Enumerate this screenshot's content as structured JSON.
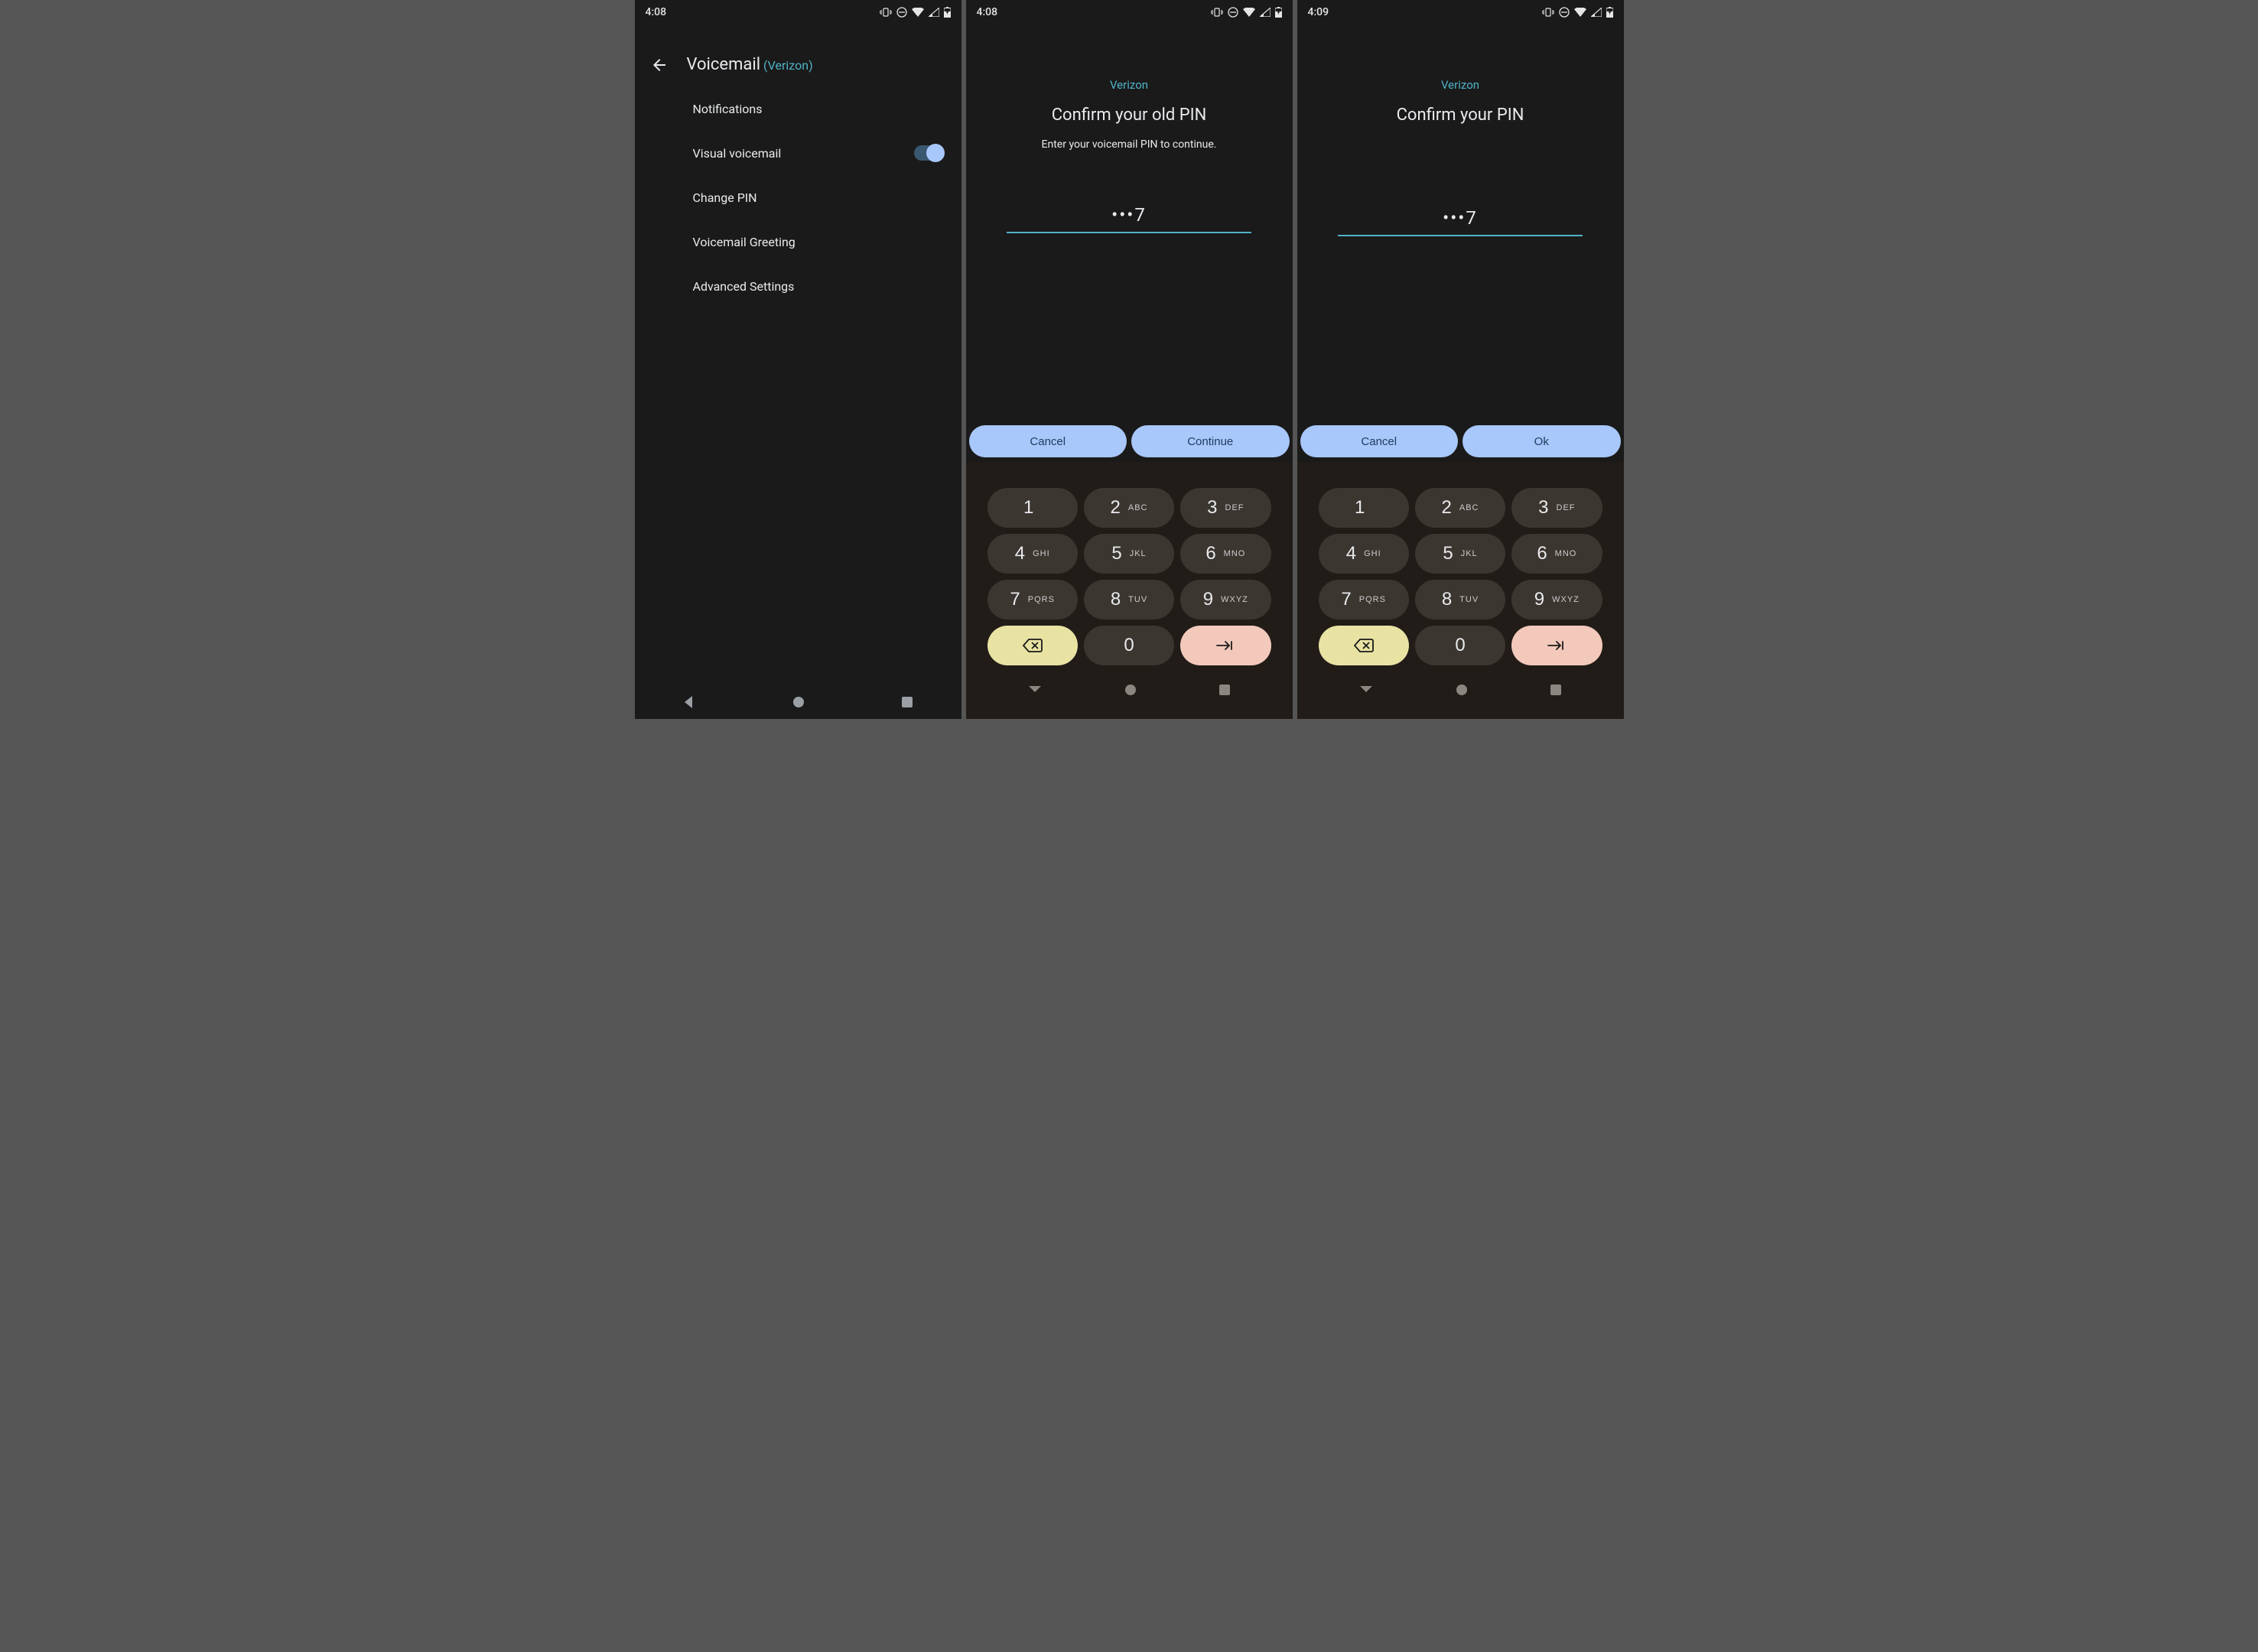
{
  "status": {
    "time_a": "4:08",
    "time_b": "4:08",
    "time_c": "4:09"
  },
  "settings": {
    "title": "Voicemail",
    "carrier": "(Verizon)",
    "items": {
      "notifications": "Notifications",
      "visual_vm": "Visual voicemail",
      "change_pin": "Change PIN",
      "greeting": "Voicemail Greeting",
      "advanced": "Advanced Settings"
    }
  },
  "pin_old": {
    "carrier": "Verizon",
    "title": "Confirm your old PIN",
    "subtitle": "Enter your voicemail PIN to continue.",
    "value": "•••7",
    "cancel": "Cancel",
    "continue": "Continue"
  },
  "pin_confirm": {
    "carrier": "Verizon",
    "title": "Confirm your PIN",
    "value": "•••7",
    "cancel": "Cancel",
    "ok": "Ok"
  },
  "keypad": {
    "k1": {
      "d": "1",
      "l": ""
    },
    "k2": {
      "d": "2",
      "l": "ABC"
    },
    "k3": {
      "d": "3",
      "l": "DEF"
    },
    "k4": {
      "d": "4",
      "l": "GHI"
    },
    "k5": {
      "d": "5",
      "l": "JKL"
    },
    "k6": {
      "d": "6",
      "l": "MNO"
    },
    "k7": {
      "d": "7",
      "l": "PQRS"
    },
    "k8": {
      "d": "8",
      "l": "TUV"
    },
    "k9": {
      "d": "9",
      "l": "WXYZ"
    },
    "k0": {
      "d": "0",
      "l": ""
    }
  }
}
